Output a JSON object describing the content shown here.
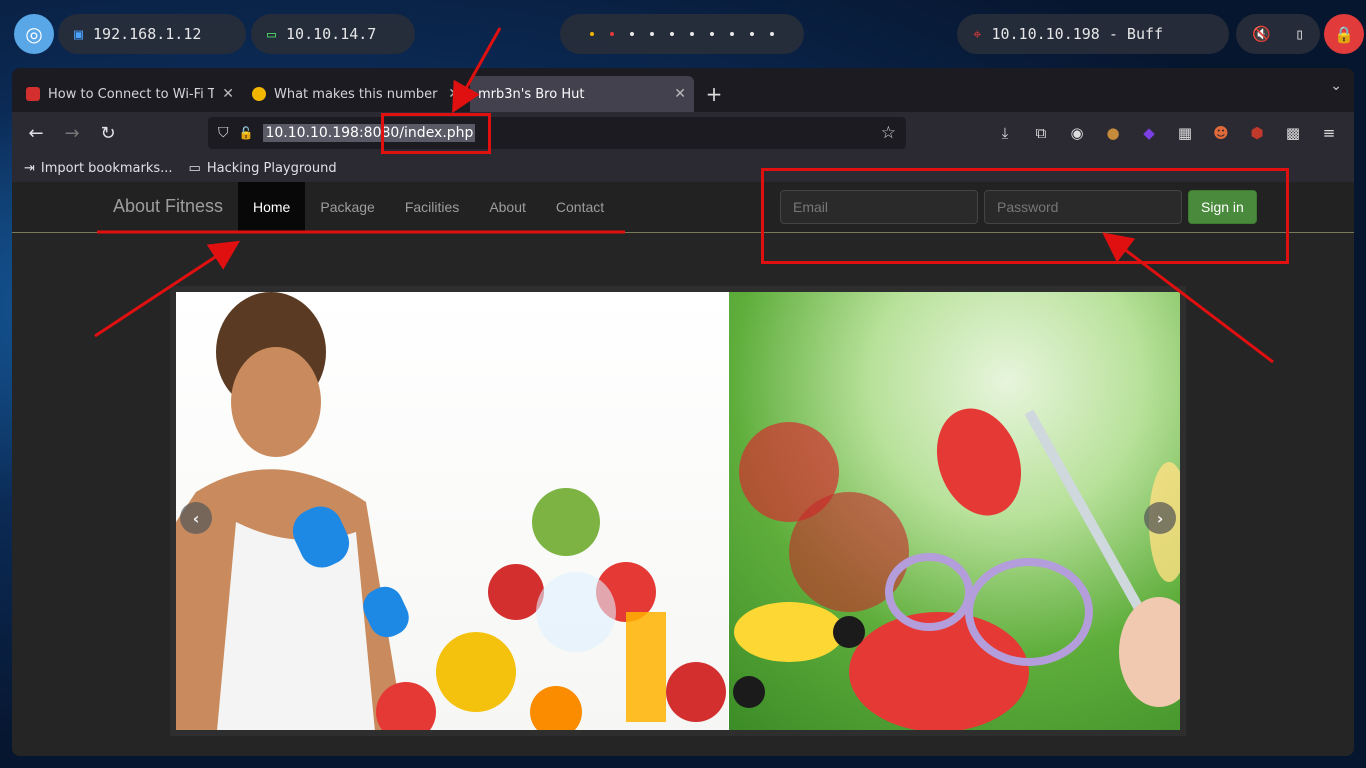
{
  "desktop": {
    "local_ip": "192.168.1.12",
    "vpn_ip": "10.10.14.7",
    "target": "10.10.10.198 - Buff"
  },
  "browser": {
    "tabs": [
      {
        "title": "How to Connect to Wi-Fi Th",
        "favicon_color": "#d32f2f"
      },
      {
        "title": "What makes this number s",
        "favicon_color": "#f2b600"
      },
      {
        "title": "mrb3n's Bro Hut",
        "favicon_color": ""
      }
    ],
    "url": {
      "host": "10.10.10.198:8080",
      "path": "/index.php"
    },
    "bookmarks": [
      "Import bookmarks...",
      "Hacking Playground"
    ]
  },
  "site": {
    "brand": "About Fitness",
    "menu": [
      "Home",
      "Package",
      "Facilities",
      "About",
      "Contact"
    ],
    "email_placeholder": "Email",
    "password_placeholder": "Password",
    "signin_label": "Sign in",
    "colors": {
      "signin": "#4a8a3c",
      "annotation": "#e01010"
    }
  }
}
